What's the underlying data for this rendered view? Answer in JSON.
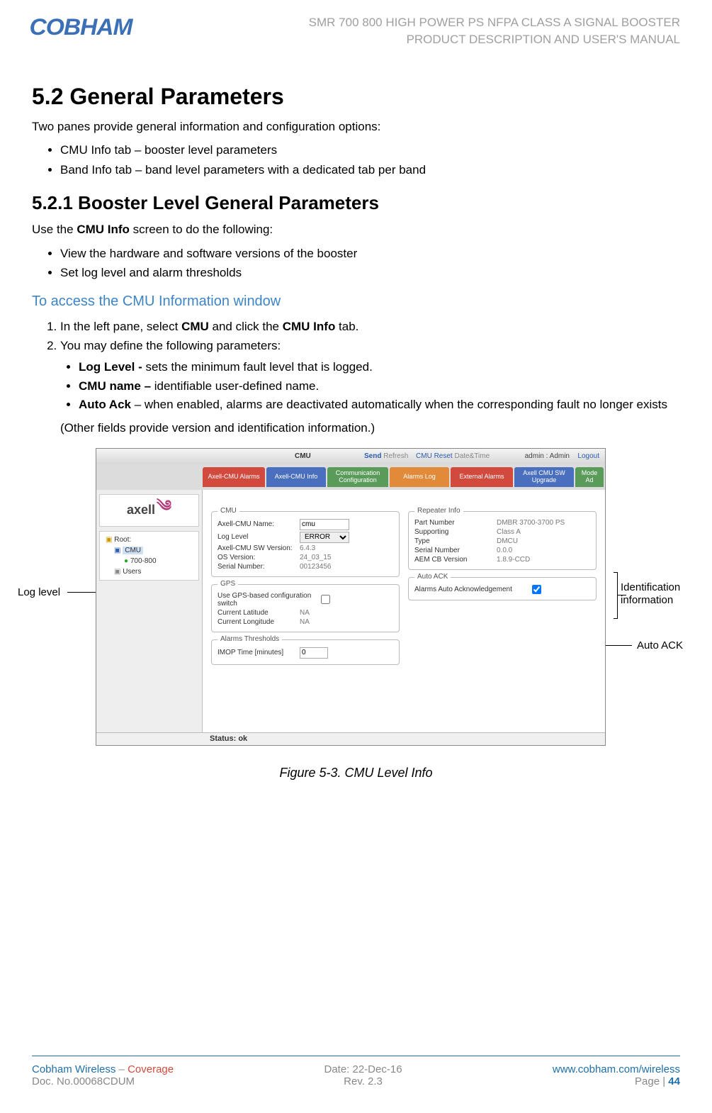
{
  "header": {
    "logo_text": "COBHAM",
    "title_line1": "SMR 700 800 HIGH POWER PS NFPA CLASS A SIGNAL BOOSTER",
    "title_line2": "PRODUCT DESCRIPTION AND USER'S MANUAL"
  },
  "section": {
    "num_title": "5.2   General Parameters",
    "intro": "Two panes provide general information and configuration options:",
    "bullets": [
      "CMU Info tab – booster level parameters",
      "Band Info tab – band level parameters with a dedicated tab per band"
    ]
  },
  "subsection": {
    "num_title": "5.2.1   Booster Level General Parameters",
    "intro_prefix": "Use the ",
    "intro_bold": "CMU Info",
    "intro_suffix": " screen to do the following:",
    "bullets": [
      "View the hardware and software versions of the booster",
      "Set log level and alarm  thresholds"
    ]
  },
  "access": {
    "heading": "To access the CMU Information window",
    "step1_prefix": "In the left pane, select ",
    "step1_b1": "CMU",
    "step1_mid": " and click the ",
    "step1_b2": "CMU Info",
    "step1_suffix": " tab.",
    "step2": "You may define the following parameters:",
    "sub": [
      {
        "bold": "Log Level - ",
        "rest": "sets the minimum fault level that is logged."
      },
      {
        "bold": "CMU name – ",
        "rest": " identifiable user-defined name."
      },
      {
        "bold": "Auto Ack",
        "rest": " – when enabled, alarms are deactivated automatically when the corresponding fault no longer exists"
      }
    ],
    "other": "(Other fields provide version and identification information.)"
  },
  "annotations": {
    "log_level": "Log level",
    "identification": "Identification information",
    "auto_ack": "Auto ACK"
  },
  "screenshot": {
    "topbar": {
      "cmu": "CMU",
      "send": "Send",
      "refresh": "Refresh",
      "reset": "CMU Reset",
      "datetime": "Date&Time",
      "admin": "admin : Admin",
      "logout": "Logout"
    },
    "tabs": [
      "Axell-CMU Alarms",
      "Axell-CMU Info",
      "Communication Configuration",
      "Alarms Log",
      "External Alarms",
      "Axell CMU SW Upgrade",
      "Mode Ad"
    ],
    "side_logo": "axell",
    "tree": {
      "root": "Root:",
      "cmu": "CMU",
      "band": "700-800",
      "users": "Users"
    },
    "cmu_group": {
      "title": "CMU",
      "name_k": "Axell-CMU Name:",
      "name_v": "cmu",
      "log_k": "Log Level",
      "log_v": "ERROR",
      "sw_k": "Axell-CMU SW Version:",
      "sw_v": "6.4.3",
      "os_k": "OS Version:",
      "os_v": "24_03_15",
      "sn_k": "Serial Number:",
      "sn_v": "00123456"
    },
    "gps_group": {
      "title": "GPS",
      "use_k": "Use GPS-based configuration switch",
      "lat_k": "Current Latitude",
      "lat_v": "NA",
      "lon_k": "Current Longitude",
      "lon_v": "NA"
    },
    "thresh_group": {
      "title": "Alarms Thresholds",
      "imop_k": "IMOP Time [minutes]",
      "imop_v": "0"
    },
    "rep_group": {
      "title": "Repeater Info",
      "pn_k": "Part Number",
      "pn_v": "DMBR 3700-3700 PS",
      "sup_k": "Supporting",
      "sup_v": "Class A",
      "type_k": "Type",
      "type_v": "DMCU",
      "sn_k": "Serial Number",
      "sn_v": "0.0.0",
      "aem_k": "AEM CB Version",
      "aem_v": "1.8.9-CCD"
    },
    "ack_group": {
      "title": "Auto ACK",
      "ack_k": "Alarms Auto Acknowledgement"
    },
    "status_label": "Status: ok"
  },
  "caption": "Figure 5-3. CMU Level Info",
  "footer": {
    "brand1": "Cobham Wireless",
    "dash": " – ",
    "brand2": "Coverage",
    "doc": "Doc. No.00068CDUM",
    "date": "Date: 22-Dec-16",
    "rev": "Rev. 2.3",
    "url": "www.cobham.com/wireless",
    "page_label": "Page | ",
    "page_num": "44"
  }
}
